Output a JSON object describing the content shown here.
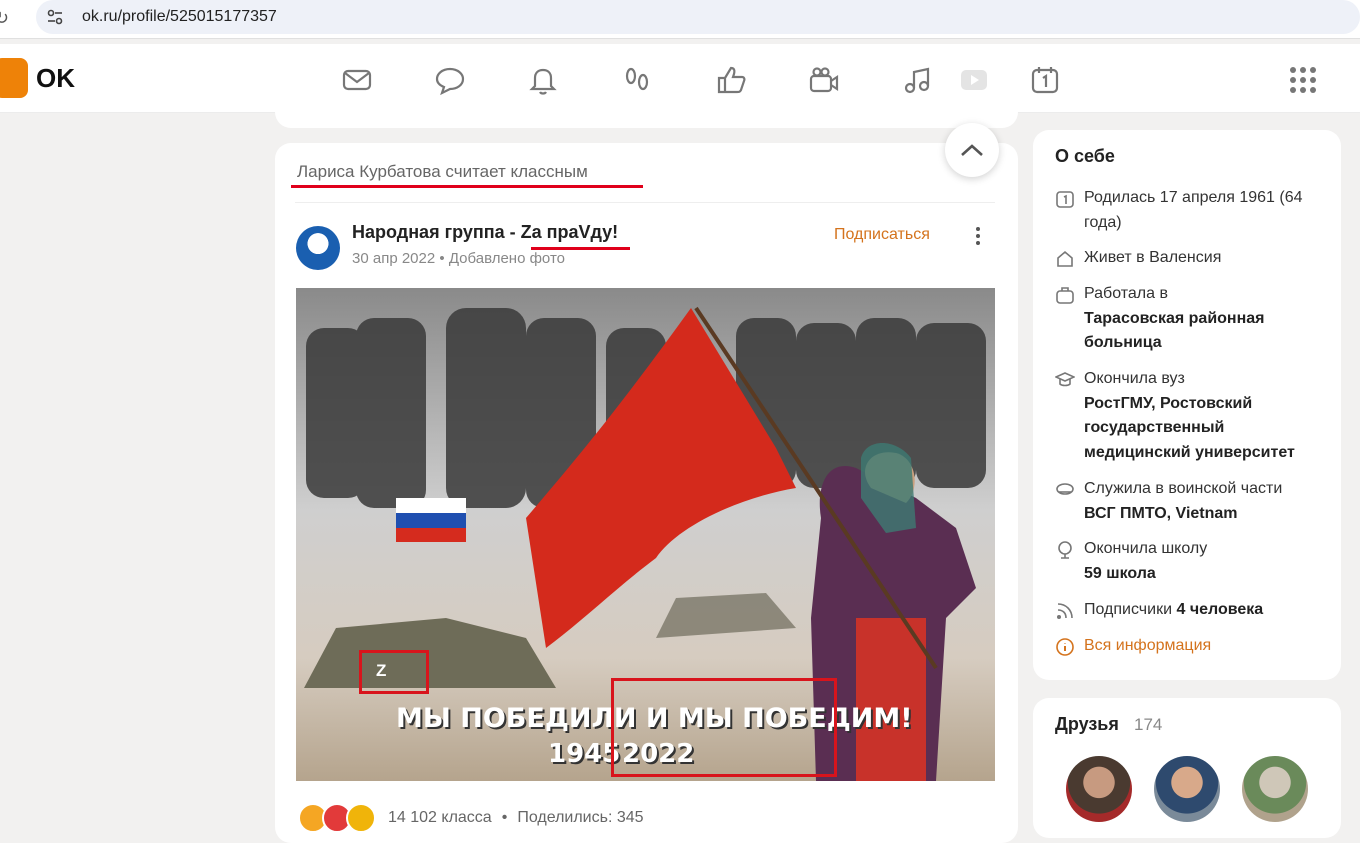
{
  "browser": {
    "url": "ok.ru/profile/525015177357"
  },
  "brand": {
    "logo_text": "OK",
    "accent": "#ee8208"
  },
  "nav": {
    "icons": [
      "mail-icon",
      "chat-icon",
      "bell-icon",
      "footprints-icon",
      "thumbs-up-icon",
      "video-camera-icon",
      "music-note-icon",
      "video-play-icon",
      "calendar-icon",
      "apps-grid-icon"
    ]
  },
  "post": {
    "liked_by": "Лариса Курбатова считает классным",
    "group_prefix": "Народная группа - ",
    "group_highlight": "Za праVду",
    "group_suffix": "!",
    "date": "30 апр 2022",
    "sep": "•",
    "action": "Добавлено фото",
    "subscribe": "Подписаться",
    "image_caption_1": "МЫ ПОБЕДИЛИ И МЫ ПОБЕДИМ!",
    "image_year_1": "1945",
    "image_year_2": "2022",
    "tank_mark": "Z",
    "likes": "14 102 класса",
    "shares": "Поделились: 345"
  },
  "about": {
    "title": "О себе",
    "born": "Родилась 17 апреля 1961 (64 года)",
    "lives_prefix": "Живет в ",
    "lives": "Валенсия",
    "worked_prefix": "Работала в",
    "worked": "Тарасовская районная больница",
    "uni_prefix": "Окончила вуз",
    "uni": "РостГМУ, Ростовский государственный медицинский университет",
    "army_prefix": "Служила в воинской части",
    "army": "ВСГ ПМТО, Vietnam",
    "school_prefix": "Окончила школу",
    "school": "59 школа",
    "subs_prefix": "Подписчики ",
    "subs": "4 человека",
    "all_info": "Вся информация"
  },
  "friends": {
    "title": "Друзья",
    "count": "174"
  },
  "colors": {
    "accent": "#ee8208",
    "link": "#d4731d",
    "highlight_red": "#e0001b",
    "soviet_red": "#d42a1c"
  }
}
